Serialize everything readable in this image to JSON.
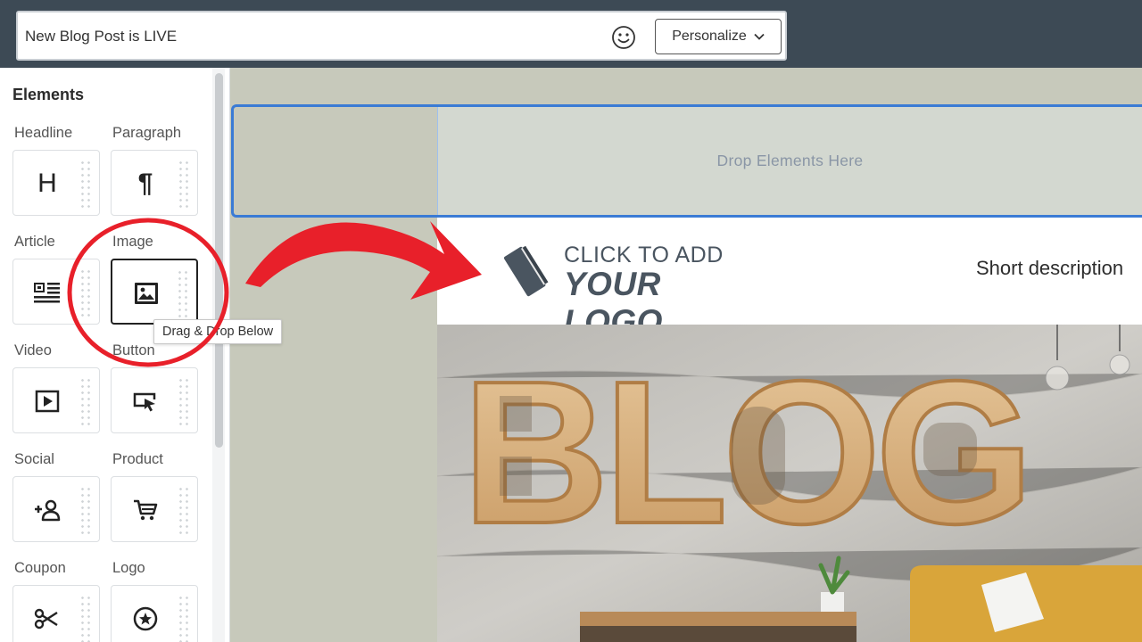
{
  "header": {
    "subject_value": "New Blog Post is LIVE",
    "personalize_label": "Personalize"
  },
  "sidebar": {
    "title": "Elements",
    "items": [
      {
        "label": "Headline",
        "icon": "headline-icon"
      },
      {
        "label": "Paragraph",
        "icon": "paragraph-icon"
      },
      {
        "label": "Article",
        "icon": "article-icon"
      },
      {
        "label": "Image",
        "icon": "image-icon"
      },
      {
        "label": "Video",
        "icon": "video-icon"
      },
      {
        "label": "Button",
        "icon": "button-cursor-icon"
      },
      {
        "label": "Social",
        "icon": "add-user-icon"
      },
      {
        "label": "Product",
        "icon": "cart-icon"
      },
      {
        "label": "Coupon",
        "icon": "scissors-icon"
      },
      {
        "label": "Logo",
        "icon": "star-badge-icon"
      }
    ],
    "headline_glyph": "H",
    "paragraph_glyph": "¶",
    "tooltip": "Drag & Drop Below"
  },
  "canvas": {
    "drop_placeholder": "Drop Elements Here",
    "logo_line1": "CLICK TO ADD",
    "logo_line2": "YOUR LOGO",
    "short_description": "Short description",
    "hero_text": "BLOG"
  },
  "colors": {
    "topbar": "#3d4a55",
    "canvas_bg": "#c7c9bb",
    "drop_border": "#3a7bd5",
    "annotation_red": "#e8202a"
  }
}
